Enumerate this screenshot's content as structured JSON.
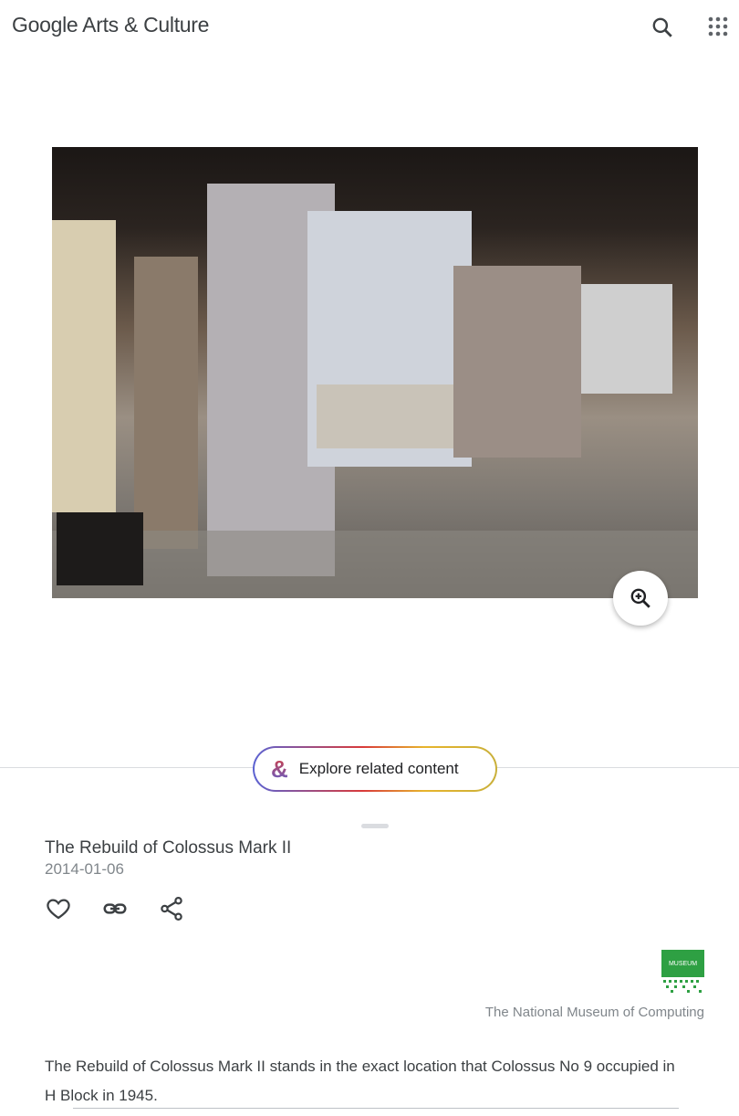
{
  "header": {
    "logo_text": "Google Arts & Culture",
    "icons": [
      "search-icon",
      "apps-grid-icon"
    ]
  },
  "artwork": {
    "image_alt": "The Rebuild of Colossus Mark II",
    "zoom_icon": "zoom-in-icon"
  },
  "explore": {
    "label": "Explore related content"
  },
  "details": {
    "title": "The Rebuild of Colossus Mark II",
    "date": "2014-01-06",
    "actions": [
      "heart-icon",
      "link-icon",
      "share-icon"
    ]
  },
  "partner": {
    "name": "The National Museum of Computing",
    "logo_color": "#2ea043"
  },
  "description": "The Rebuild of Colossus Mark II stands in the exact location that Colossus No 9 occupied in H Block in 1945."
}
